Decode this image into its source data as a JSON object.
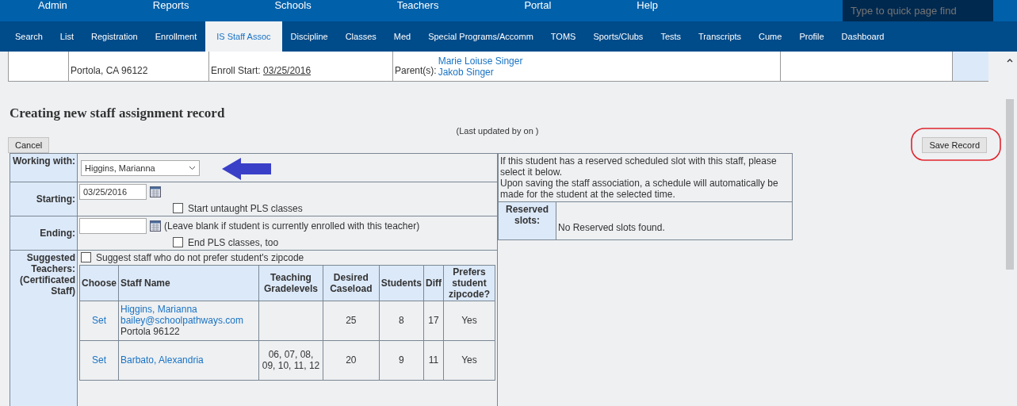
{
  "top_menu": [
    "Admin",
    "Reports",
    "Schools",
    "Teachers",
    "Portal",
    "Help"
  ],
  "quick_find": {
    "placeholder": "Type to quick page find"
  },
  "tabs": [
    {
      "label": "Search",
      "selected": false
    },
    {
      "label": "List",
      "selected": false
    },
    {
      "label": "Registration",
      "selected": false
    },
    {
      "label": "Enrollment",
      "selected": false
    },
    {
      "label": "IS Staff Assoc",
      "selected": true
    },
    {
      "label": "Discipline",
      "selected": false
    },
    {
      "label": "Classes",
      "selected": false
    },
    {
      "label": "Med",
      "selected": false
    },
    {
      "label": "Special Programs/Accomm",
      "selected": false
    },
    {
      "label": "TOMS",
      "selected": false
    },
    {
      "label": "Sports/Clubs",
      "selected": false
    },
    {
      "label": "Tests",
      "selected": false
    },
    {
      "label": "Transcripts",
      "selected": false
    },
    {
      "label": "Cume",
      "selected": false
    },
    {
      "label": "Profile",
      "selected": false
    },
    {
      "label": "Dashboard",
      "selected": false
    }
  ],
  "student": {
    "address": "Portola, CA 96122",
    "enroll_label": "Enroll Start:",
    "enroll_date": "03/25/2016",
    "parents_label": "Parent(s):",
    "parents": [
      "Marie Loiuse Singer",
      "Jakob Singer"
    ]
  },
  "heading": "Creating new staff assignment record",
  "last_updated": "(Last updated by on )",
  "cancel_button": "Cancel",
  "save_button": "Save Record",
  "form": {
    "working_label": "Working with:",
    "working_value": "Higgins, Marianna",
    "starting_label": "Starting:",
    "starting_value": "03/25/2016",
    "start_pls": {
      "label": "Start untaught PLS classes",
      "checked": false
    },
    "ending_label": "Ending:",
    "ending_hint": "(Leave blank if student is currently enrolled with this teacher)",
    "end_pls": {
      "label": "End PLS classes, too",
      "checked": false
    },
    "suggested_label": "Suggested Teachers: (Certificated Staff)",
    "suggest_other": {
      "label": "Suggest staff who do not prefer student's zipcode",
      "checked": false
    }
  },
  "staff_table": {
    "columns": [
      "Choose",
      "Staff Name",
      "Teaching Gradelevels",
      "Desired Caseload",
      "Students",
      "Diff",
      "Prefers student zipcode?"
    ],
    "rows": [
      {
        "choose": "Set",
        "name": "Higgins, Marianna",
        "email": "bailey@schoolpathways.com",
        "location": "Portola 96122",
        "gradelevels": "",
        "caseload": "25",
        "students": "8",
        "diff": "17",
        "prefers": "Yes"
      },
      {
        "choose": "Set",
        "name": "Barbato, Alexandria",
        "gradelevels": "06, 07, 08, 09, 10, 11, 12",
        "caseload": "20",
        "students": "9",
        "diff": "11",
        "prefers": "Yes"
      }
    ]
  },
  "reserved": {
    "info": [
      "If this student has a reserved scheduled slot with this staff, please select it below.",
      "Upon saving the staff association, a schedule will automatically be made for the student at the selected time."
    ],
    "label": "Reserved slots:",
    "empty": "No Reserved slots found."
  }
}
